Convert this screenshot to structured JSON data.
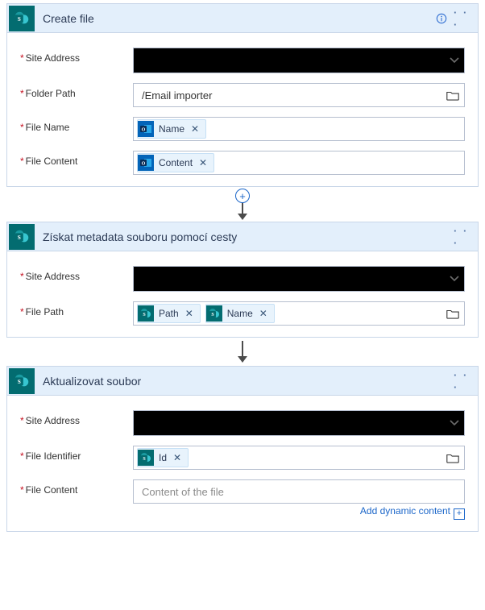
{
  "cards": [
    {
      "title": "Create file",
      "showInfo": true,
      "fields": [
        {
          "label": "Site Address",
          "required": true,
          "kind": "blackout-select"
        },
        {
          "label": "Folder Path",
          "required": true,
          "kind": "text-folder",
          "value": "/Email importer"
        },
        {
          "label": "File Name",
          "required": true,
          "kind": "tokens",
          "tokens": [
            {
              "icon": "outlook",
              "label": "Name"
            }
          ]
        },
        {
          "label": "File Content",
          "required": true,
          "kind": "tokens",
          "tokens": [
            {
              "icon": "outlook",
              "label": "Content"
            }
          ]
        }
      ]
    },
    {
      "title": "Získat metadata souboru pomocí cesty",
      "showInfo": false,
      "fields": [
        {
          "label": "Site Address",
          "required": true,
          "kind": "blackout-select"
        },
        {
          "label": "File Path",
          "required": true,
          "kind": "tokens-folder",
          "tokens": [
            {
              "icon": "sharepoint",
              "label": "Path"
            },
            {
              "icon": "sharepoint",
              "label": "Name"
            }
          ]
        }
      ]
    },
    {
      "title": "Aktualizovat soubor",
      "showInfo": false,
      "fields": [
        {
          "label": "Site Address",
          "required": true,
          "kind": "blackout-select"
        },
        {
          "label": "File Identifier",
          "required": true,
          "kind": "tokens-folder",
          "tokens": [
            {
              "icon": "sharepoint",
              "label": "Id"
            }
          ]
        },
        {
          "label": "File Content",
          "required": true,
          "kind": "placeholder",
          "value": "Content of the file",
          "dynLink": true
        }
      ]
    }
  ],
  "connectors": [
    {
      "plus": true
    },
    {
      "plus": false
    }
  ],
  "strings": {
    "addDynamic": "Add dynamic content"
  }
}
